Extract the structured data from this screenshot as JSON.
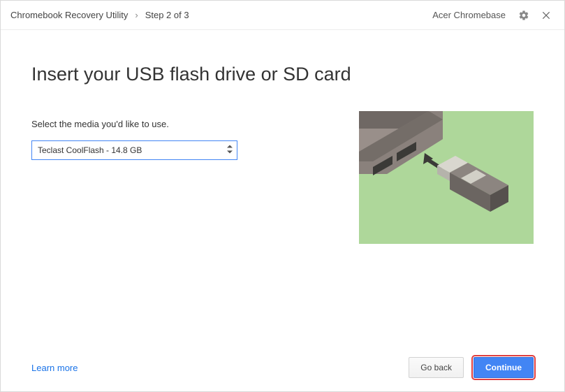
{
  "titlebar": {
    "app_name": "Chromebook Recovery Utility",
    "separator": "›",
    "step_label": "Step 2 of 3",
    "device_name": "Acer Chromebase"
  },
  "main": {
    "title": "Insert your USB flash drive or SD card",
    "media_prompt": "Select the media you'd like to use.",
    "media_selected": "Teclast CoolFlash - 14.8 GB"
  },
  "footer": {
    "learn_more": "Learn more",
    "back_label": "Go back",
    "continue_label": "Continue"
  }
}
